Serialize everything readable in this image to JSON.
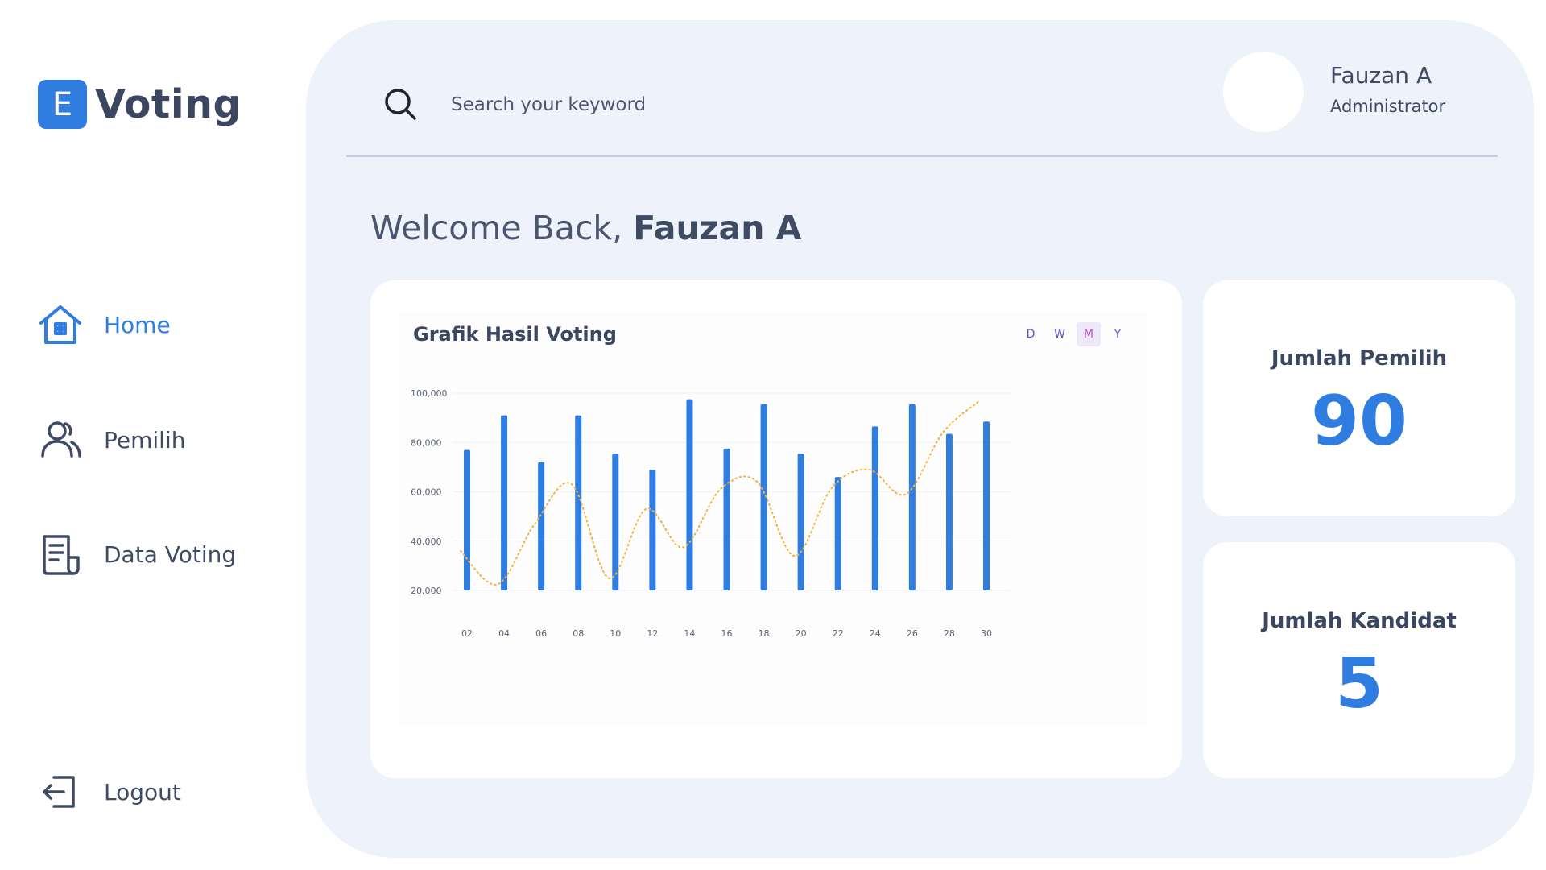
{
  "app": {
    "logo_letter": "E",
    "logo_text": "Voting"
  },
  "sidebar": {
    "items": [
      {
        "label": "Home",
        "icon": "home-icon",
        "active": true
      },
      {
        "label": "Pemilih",
        "icon": "users-icon",
        "active": false
      },
      {
        "label": "Data Voting",
        "icon": "document-icon",
        "active": false
      }
    ],
    "logout_label": "Logout"
  },
  "header": {
    "search_placeholder": "Search your keyword",
    "user_name": "Fauzan A",
    "user_role": "Administrator"
  },
  "welcome": {
    "prefix": "Welcome Back,",
    "name": "Fauzan A"
  },
  "chart_card": {
    "title": "Grafik Hasil Voting",
    "ranges": [
      "D",
      "W",
      "M",
      "Y"
    ],
    "active_range": "M"
  },
  "stats": {
    "pemilih": {
      "label": "Jumlah Pemilih",
      "value": "90"
    },
    "kandidat": {
      "label": "Jumlah Kandidat",
      "value": "5"
    }
  },
  "colors": {
    "accent": "#2f7de1",
    "line": "#f5b23a",
    "panel": "#edf2fb",
    "text": "#3f4a63"
  },
  "chart_data": {
    "type": "bar",
    "categories": [
      "02",
      "04",
      "06",
      "08",
      "10",
      "12",
      "14",
      "16",
      "18",
      "20",
      "22",
      "24",
      "26",
      "28",
      "30"
    ],
    "series": [
      {
        "type": "bar",
        "values": [
          77000,
          91000,
          72000,
          91000,
          75500,
          69000,
          97500,
          77500,
          95500,
          75500,
          66000,
          86500,
          95500,
          83500,
          88500
        ]
      },
      {
        "type": "line",
        "style": "dotted",
        "values": [
          36000,
          22500,
          47000,
          63000,
          25000,
          53000,
          37500,
          61000,
          64000,
          34000,
          61500,
          69000,
          59000,
          84000,
          97000
        ]
      }
    ],
    "y_ticks": [
      "100,000",
      "80,000",
      "60,000",
      "40,000",
      "20,000"
    ],
    "ylim": [
      20000,
      100000
    ],
    "grid": true
  }
}
